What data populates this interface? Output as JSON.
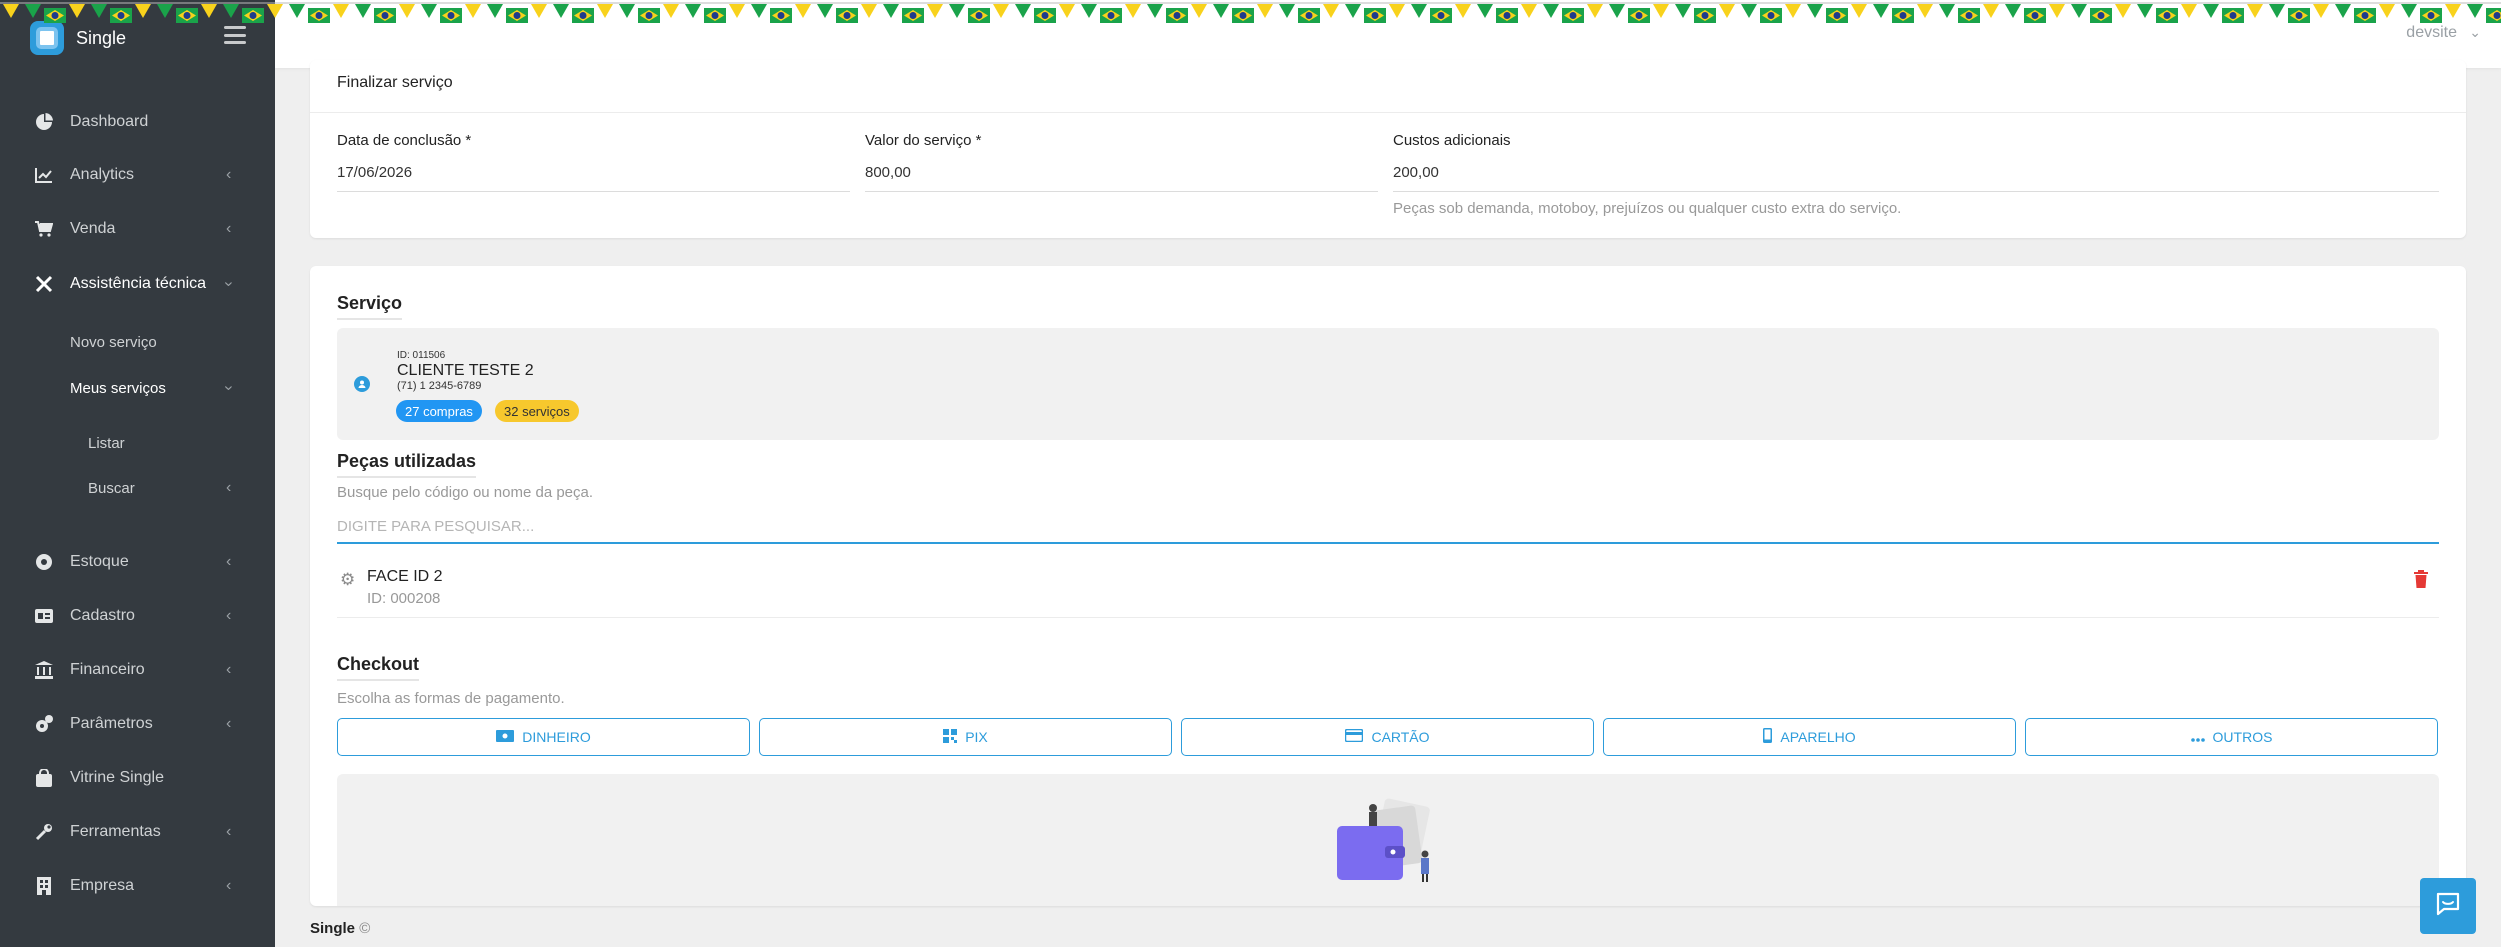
{
  "app": {
    "brand": "Single"
  },
  "sidebar": {
    "items": [
      {
        "label": "Dashboard"
      },
      {
        "label": "Analytics"
      },
      {
        "label": "Venda"
      },
      {
        "label": "Assistência técnica"
      },
      {
        "label": "Novo serviço"
      },
      {
        "label": "Meus serviços"
      },
      {
        "label": "Listar"
      },
      {
        "label": "Buscar"
      },
      {
        "label": "Estoque"
      },
      {
        "label": "Cadastro"
      },
      {
        "label": "Financeiro"
      },
      {
        "label": "Parâmetros"
      },
      {
        "label": "Vitrine Single"
      },
      {
        "label": "Ferramentas"
      },
      {
        "label": "Empresa"
      }
    ]
  },
  "topbar": {
    "user": "devsite"
  },
  "finalizar": {
    "title": "Finalizar serviço",
    "data_label": "Data de conclusão *",
    "data_value": "17/06/2026",
    "valor_label": "Valor do serviço *",
    "valor_value": "800,00",
    "custos_label": "Custos adicionais",
    "custos_value": "200,00",
    "custos_hint": "Peças sob demanda, motoboy, prejuízos ou qualquer custo extra do serviço."
  },
  "servico": {
    "title": "Serviço",
    "client": {
      "id": "ID: 011506",
      "name": "CLIENTE TESTE 2",
      "phone": "(71) 1 2345-6789",
      "badge_compras": "27 compras",
      "badge_servicos": "32 serviços"
    }
  },
  "pecas": {
    "title": "Peças utilizadas",
    "hint": "Busque pelo código ou nome da peça.",
    "search_placeholder": "DIGITE PARA PESQUISAR...",
    "items": [
      {
        "name": "FACE ID 2",
        "id": "ID: 000208"
      }
    ]
  },
  "checkout": {
    "title": "Checkout",
    "hint": "Escolha as formas de pagamento.",
    "buttons": [
      {
        "label": "DINHEIRO",
        "icon": "money-icon"
      },
      {
        "label": "PIX",
        "icon": "pix-icon"
      },
      {
        "label": "CARTÃO",
        "icon": "card-icon"
      },
      {
        "label": "APARELHO",
        "icon": "phone-icon"
      },
      {
        "label": "OUTROS",
        "icon": "more-icon"
      }
    ]
  },
  "footer": {
    "brand": "Single",
    "copyright": "©"
  },
  "colors": {
    "accent": "#2d9cdb",
    "sidebar": "#343a40",
    "danger": "#e53935",
    "badge_blue": "#2196f3",
    "badge_yellow": "#f7c82d"
  }
}
